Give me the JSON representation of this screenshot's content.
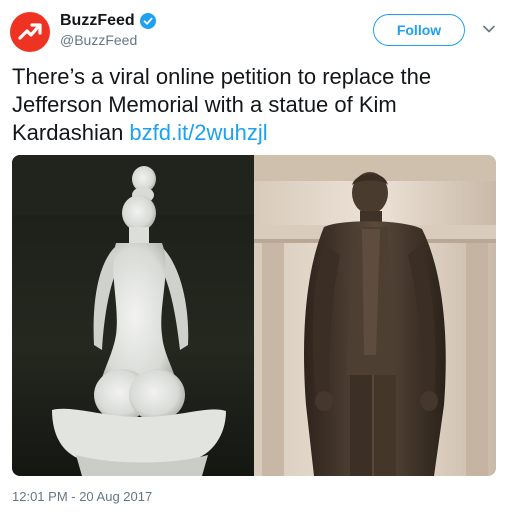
{
  "author": {
    "display_name": "BuzzFeed",
    "handle": "@BuzzFeed",
    "verified": true,
    "avatar_icon": "trending-arrow-icon",
    "avatar_color": "#ee3322"
  },
  "actions": {
    "follow_label": "Follow",
    "menu_icon": "chevron-down-icon"
  },
  "tweet": {
    "text": "There’s a viral online petition to replace the Jefferson Memorial with a statue of Kim Kardashian ",
    "link": "bzfd.it/2wuhzjl",
    "link_color": "#1da1f2"
  },
  "media": {
    "left_image": "white sculpture photo",
    "right_image": "bronze statue photo"
  },
  "meta": {
    "timestamp": "12:01 PM - 20 Aug 2017"
  }
}
